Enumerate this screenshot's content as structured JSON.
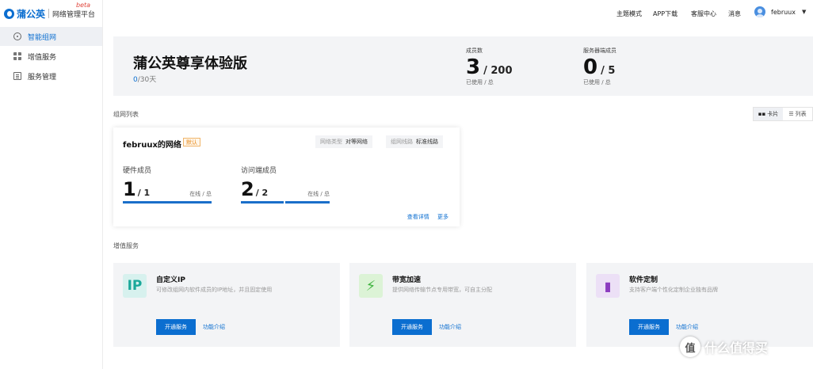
{
  "brand": {
    "name": "蒲公英",
    "subtitle": "网络管理平台",
    "beta": "beta"
  },
  "sidebar": {
    "items": [
      {
        "label": "智能组网",
        "icon": "network-icon",
        "active": true
      },
      {
        "label": "增值服务",
        "icon": "apps-grid-icon",
        "active": false
      },
      {
        "label": "服务管理",
        "icon": "document-icon",
        "active": false
      }
    ]
  },
  "topbar": {
    "links": [
      "主题模式",
      "APP下载",
      "客服中心",
      "消息"
    ],
    "username": "februux",
    "caret": "▼"
  },
  "hero": {
    "title": "蒲公英尊享体验版",
    "days_used": "0",
    "days_total": "/30天",
    "stats": [
      {
        "label": "成员数",
        "value": "3",
        "total": "/ 200",
        "foot": "已使用 / 总"
      },
      {
        "label": "服务器端成员",
        "value": "0",
        "total": "/ 5",
        "foot": "已使用 / 总"
      }
    ]
  },
  "network_list": {
    "title": "组网列表",
    "view_card": "卡片",
    "view_list": "列表",
    "card": {
      "name": "februux的网络",
      "badge": "默认",
      "tags": [
        {
          "key": "网络类型",
          "value": "对等网络"
        },
        {
          "key": "组网线路",
          "value": "标准线路"
        }
      ],
      "members": [
        {
          "label": "硬件成员",
          "value": "1",
          "total": "/ 1",
          "status": "在线 / 总"
        },
        {
          "label": "访问端成员",
          "value": "2",
          "total": "/ 2",
          "status": "在线 / 总"
        }
      ],
      "links": [
        "查看详情",
        "更多"
      ]
    }
  },
  "services": {
    "title": "增值服务",
    "items": [
      {
        "name": "自定义IP",
        "desc": "可修改组网内软件成员的IP地址，并且固定使用",
        "icon": "ip-icon",
        "icon_text": "IP",
        "color": "#1aa89a",
        "bg": "#d7f1ee",
        "button": "开通服务",
        "link": "功能介绍"
      },
      {
        "name": "带宽加速",
        "desc": "提供网络传输节点专用带宽，可自主分配",
        "icon": "lightning-icon",
        "icon_text": "⚡",
        "color": "#3fb33f",
        "bg": "#dcf3d6",
        "button": "开通服务",
        "link": "功能介绍"
      },
      {
        "name": "软件定制",
        "desc": "支持客户端个性化定制企业独有品牌",
        "icon": "package-icon",
        "icon_text": "▮",
        "color": "#8b3bbf",
        "bg": "#ece0f6",
        "button": "开通服务",
        "link": "功能介绍"
      }
    ]
  },
  "watermark": {
    "text": "什么值得买",
    "icon_text": "值"
  }
}
